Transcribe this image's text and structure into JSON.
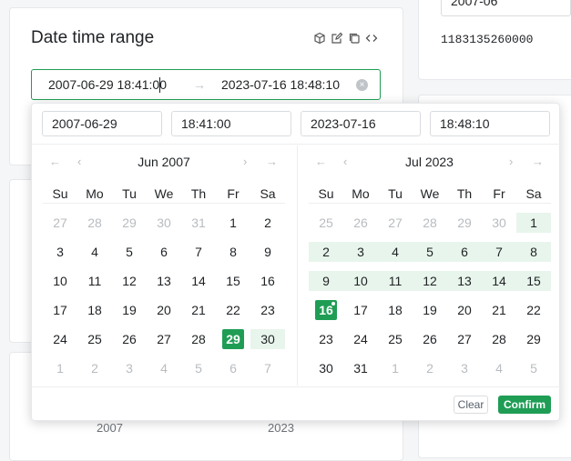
{
  "card": {
    "title": "Date time range"
  },
  "toolbar": {
    "icons": [
      "cube-icon",
      "edit-icon",
      "copy-icon",
      "code-icon"
    ]
  },
  "range": {
    "start": "2007-06-29 18:41:00",
    "arrow": "→",
    "end": "2023-07-16 18:48:10",
    "clear_icon": "×"
  },
  "right_panel": {
    "value": "2007-06",
    "number": "1183135260000"
  },
  "inputs": {
    "start_date": "2007-06-29",
    "start_time": "18:41:00",
    "end_date": "2023-07-16",
    "end_time": "18:48:10"
  },
  "weekdays": [
    "Su",
    "Mo",
    "Tu",
    "We",
    "Th",
    "Fr",
    "Sa"
  ],
  "left_calendar": {
    "month": "Jun 2007",
    "weeks": [
      [
        "27",
        "28",
        "29",
        "30",
        "31",
        "1",
        "2"
      ],
      [
        "3",
        "4",
        "5",
        "6",
        "7",
        "8",
        "9"
      ],
      [
        "10",
        "11",
        "12",
        "13",
        "14",
        "15",
        "16"
      ],
      [
        "17",
        "18",
        "19",
        "20",
        "21",
        "22",
        "23"
      ],
      [
        "24",
        "25",
        "26",
        "27",
        "28",
        "29",
        "30"
      ],
      [
        "1",
        "2",
        "3",
        "4",
        "5",
        "6",
        "7"
      ]
    ]
  },
  "right_calendar": {
    "month": "Jul 2023",
    "weeks": [
      [
        "25",
        "26",
        "27",
        "28",
        "29",
        "30",
        "1"
      ],
      [
        "2",
        "3",
        "4",
        "5",
        "6",
        "7",
        "8"
      ],
      [
        "9",
        "10",
        "11",
        "12",
        "13",
        "14",
        "15"
      ],
      [
        "16",
        "17",
        "18",
        "19",
        "20",
        "21",
        "22"
      ],
      [
        "23",
        "24",
        "25",
        "26",
        "27",
        "28",
        "29"
      ],
      [
        "30",
        "31",
        "1",
        "2",
        "3",
        "4",
        "5"
      ]
    ]
  },
  "footer": {
    "clear": "Clear",
    "confirm": "Confirm"
  },
  "below": {
    "left": "2007",
    "right": "2023"
  },
  "colors": {
    "accent": "#1f9d55",
    "range_bg": "#e8f5ec"
  }
}
